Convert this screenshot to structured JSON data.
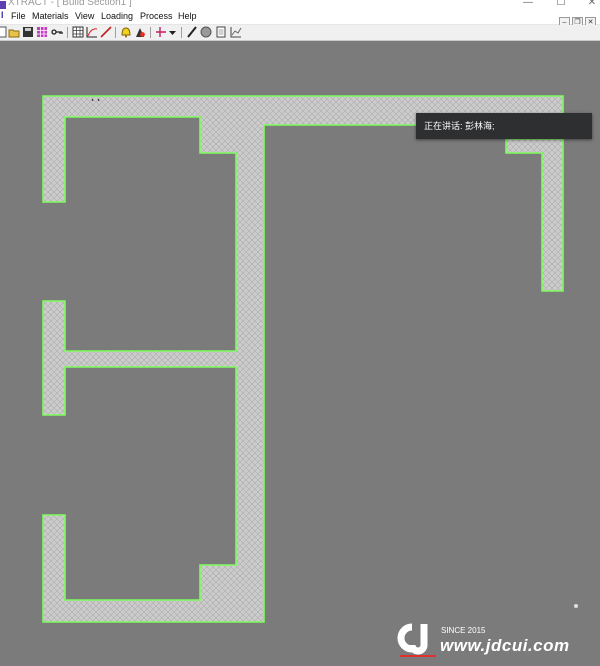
{
  "window": {
    "title": "XTRACT - [ Build Section1 ]",
    "minimize": "—",
    "maximize": "☐",
    "close": "✕"
  },
  "menu": [
    "File",
    "Materials",
    "View",
    "Loading",
    "Process",
    "Help"
  ],
  "mdi_controls": [
    "–",
    "❐",
    "✕"
  ],
  "toolbar_icons": [
    "new-icon",
    "open-icon",
    "save-icon",
    "grid-icon",
    "key-icon",
    "mesh-icon",
    "curve-icon",
    "line-icon",
    "bell-icon",
    "material-icon",
    "axis-icon",
    "dropdown-arrow-icon",
    "pen-icon",
    "sphere-icon",
    "page-icon",
    "chart-icon"
  ],
  "tooltip": "正在讲话: 彭林海;",
  "colors": {
    "background": "#7b7b7b",
    "section_fill": "#cfcfcf",
    "section_outline": "#7cfc5c",
    "tooltip_bg": "#2e2f31"
  },
  "watermark": {
    "since": "SINCE 2015",
    "url": "www.jdcui.com"
  }
}
